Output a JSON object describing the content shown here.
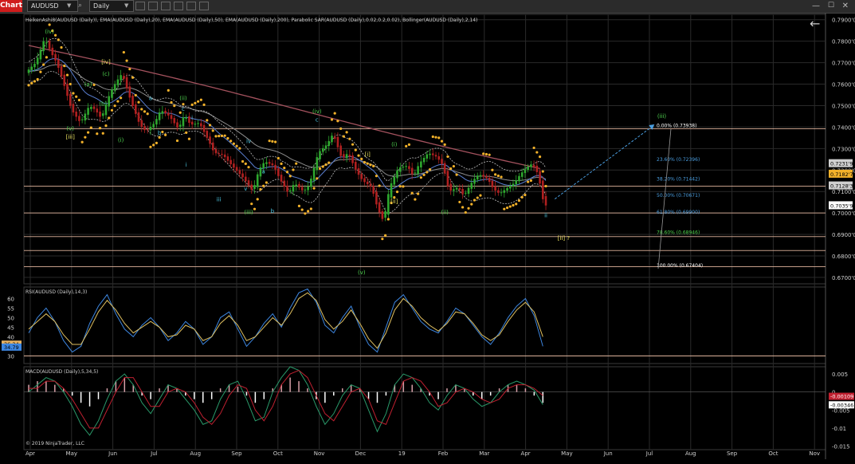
{
  "toolbar": {
    "chart_tab": "Chart",
    "symbol": "AUDUSD",
    "timeframe": "Daily"
  },
  "colors": {
    "background": "#000000",
    "grid": "#2a2a2a",
    "candle_up": "#2ea82e",
    "candle_down": "#b02020",
    "sar": "#f2b12a",
    "ema20": "#5a7fd1",
    "ema50": "#8c8c8c",
    "ema200": "#a4525e",
    "bollinger": "#bfbfbf",
    "fib_line": "#e6b8a0",
    "rsi": "#3d86e0",
    "rsi_avg": "#e0c060",
    "macd_pos": "#d8a0a8",
    "macd_neg": "#ffffff",
    "macd_line": "#2a9a6a",
    "macd_signal": "#c02030",
    "wave_green": "#4ed24e",
    "wave_yellow": "#e8e060",
    "wave_cyan": "#4cc4e0",
    "projection": "#4a9ee0"
  },
  "chart_data": [
    {
      "type": "candlestick",
      "title": "HeikenAshi8(AUDUSD (Daily)), EMA(AUDUSD (Daily),20), EMA(AUDUSD (Daily),50), EMA(AUDUSD (Daily),200), Parabolic SAR(AUDUSD (Daily),0.02,0.2,0.02), Bollinger(AUDUSD (Daily),2,14)",
      "x_labels": [
        "Apr",
        "May",
        "Jun",
        "Jul",
        "Aug",
        "Sep",
        "Oct",
        "Nov",
        "Dec",
        "19",
        "Feb",
        "Mar",
        "Apr",
        "May",
        "Jun",
        "Jul",
        "Aug",
        "Sep",
        "Oct",
        "Nov"
      ],
      "y_ticks": [
        "0.7900'0",
        "0.7800'0",
        "0.7700'0",
        "0.7600'0",
        "0.7500'0",
        "0.7400'0",
        "0.7300'0",
        "0.7200'0",
        "0.7100'0",
        "0.7000'0",
        "0.6900'0",
        "0.6800'0",
        "0.6700'0"
      ],
      "ylim": [
        0.667,
        0.7925
      ],
      "price_path": [
        [
          0,
          0.766
        ],
        [
          3,
          0.77
        ],
        [
          6,
          0.7815
        ],
        [
          8,
          0.775
        ],
        [
          10,
          0.77
        ],
        [
          12,
          0.762
        ],
        [
          15,
          0.748
        ],
        [
          18,
          0.742
        ],
        [
          21,
          0.75
        ],
        [
          23,
          0.748
        ],
        [
          25,
          0.744
        ],
        [
          28,
          0.756
        ],
        [
          30,
          0.761
        ],
        [
          32,
          0.765
        ],
        [
          35,
          0.752
        ],
        [
          38,
          0.741
        ],
        [
          40,
          0.738
        ],
        [
          43,
          0.742
        ],
        [
          45,
          0.748
        ],
        [
          48,
          0.745
        ],
        [
          51,
          0.739
        ],
        [
          53,
          0.746
        ],
        [
          55,
          0.741
        ],
        [
          58,
          0.742
        ],
        [
          61,
          0.734
        ],
        [
          63,
          0.728
        ],
        [
          66,
          0.727
        ],
        [
          69,
          0.722
        ],
        [
          71,
          0.719
        ],
        [
          73,
          0.716
        ],
        [
          76,
          0.71
        ],
        [
          78,
          0.72
        ],
        [
          80,
          0.724
        ],
        [
          83,
          0.722
        ],
        [
          85,
          0.716
        ],
        [
          88,
          0.709
        ],
        [
          90,
          0.714
        ],
        [
          93,
          0.71
        ],
        [
          95,
          0.713
        ],
        [
          98,
          0.728
        ],
        [
          101,
          0.732
        ],
        [
          103,
          0.737
        ],
        [
          106,
          0.725
        ],
        [
          108,
          0.728
        ],
        [
          111,
          0.719
        ],
        [
          113,
          0.715
        ],
        [
          116,
          0.712
        ],
        [
          118,
          0.702
        ],
        [
          120,
          0.696
        ],
        [
          122,
          0.712
        ],
        [
          125,
          0.721
        ],
        [
          128,
          0.722
        ],
        [
          130,
          0.717
        ],
        [
          132,
          0.723
        ],
        [
          135,
          0.728
        ],
        [
          138,
          0.726
        ],
        [
          140,
          0.722
        ],
        [
          142,
          0.71
        ],
        [
          145,
          0.712
        ],
        [
          147,
          0.708
        ],
        [
          150,
          0.715
        ],
        [
          152,
          0.718
        ],
        [
          155,
          0.716
        ],
        [
          157,
          0.711
        ],
        [
          159,
          0.709
        ],
        [
          161,
          0.711
        ],
        [
          164,
          0.714
        ],
        [
          166,
          0.718
        ],
        [
          168,
          0.721
        ],
        [
          170,
          0.723
        ],
        [
          172,
          0.718
        ],
        [
          174,
          0.7035
        ]
      ],
      "candle_days": 175,
      "date_range_days": 300,
      "current_price": "0.7035'9",
      "price_markers": [
        {
          "label": "0.7231'9",
          "value": 0.72319,
          "bg": "#cfcfcf",
          "fg": "#000000"
        },
        {
          "label": "0.7182'7",
          "value": 0.71827,
          "bg": "#f2b12a",
          "fg": "#000000"
        },
        {
          "label": "0.7128'3",
          "value": 0.71283,
          "bg": "#cfcfcf",
          "fg": "#000000"
        },
        {
          "label": "0.7035'9",
          "value": 0.70359,
          "bg": "#ffffff",
          "fg": "#000000"
        }
      ],
      "horizontal_levels": [
        0.7392,
        0.7125,
        0.7,
        0.689,
        0.6825,
        0.675
      ],
      "fib_levels": [
        {
          "label": "0.00% (0.73938)",
          "value": 0.7392,
          "color": "#ffffff"
        },
        {
          "label": "23.60% (0.72396)",
          "value": 0.7235,
          "color": "#4a9ee0"
        },
        {
          "label": "38.20% (0.71442)",
          "value": 0.7144,
          "color": "#4a9ee0"
        },
        {
          "label": "50.00% (0.70671)",
          "value": 0.7067,
          "color": "#4a9ee0"
        },
        {
          "label": "61.80% (0.69900)",
          "value": 0.699,
          "color": "#4a9ee0"
        },
        {
          "label": "78.60% (0.68946)",
          "value": 0.6895,
          "color": "#4ed24e"
        },
        {
          "label": "100.00% (0.67404)",
          "value": 0.674,
          "color": "#ffffff"
        }
      ],
      "wave_labels": [
        {
          "text": "(iv)",
          "day": 7,
          "price": 0.7835,
          "color": "wave_green"
        },
        {
          "text": "(a)",
          "day": 20,
          "price": 0.759,
          "color": "wave_green"
        },
        {
          "text": "(v)",
          "day": 14,
          "price": 0.7385,
          "color": "wave_green"
        },
        {
          "text": "[iii]",
          "day": 14,
          "price": 0.7345,
          "color": "wave_yellow"
        },
        {
          "text": "(b)",
          "day": 25,
          "price": 0.75,
          "color": "wave_green"
        },
        {
          "text": "[iv]",
          "day": 26,
          "price": 0.7695,
          "color": "wave_yellow"
        },
        {
          "text": "(c)",
          "day": 26,
          "price": 0.764,
          "color": "wave_green"
        },
        {
          "text": "(i)",
          "day": 31,
          "price": 0.733,
          "color": "wave_green"
        },
        {
          "text": "a",
          "day": 41,
          "price": 0.7525,
          "color": "wave_cyan"
        },
        {
          "text": "b",
          "day": 44,
          "price": 0.7365,
          "color": "wave_cyan"
        },
        {
          "text": "(ii)",
          "day": 52,
          "price": 0.7525,
          "color": "wave_green"
        },
        {
          "text": "c",
          "day": 52,
          "price": 0.7475,
          "color": "wave_cyan"
        },
        {
          "text": "i",
          "day": 55,
          "price": 0.7435,
          "color": "wave_cyan"
        },
        {
          "text": "i",
          "day": 53,
          "price": 0.7215,
          "color": "wave_cyan"
        },
        {
          "text": "iii",
          "day": 64,
          "price": 0.7055,
          "color": "wave_cyan"
        },
        {
          "text": "iv",
          "day": 74,
          "price": 0.7325,
          "color": "wave_cyan"
        },
        {
          "text": "a",
          "day": 79,
          "price": 0.7185,
          "color": "wave_cyan"
        },
        {
          "text": "v",
          "day": 73,
          "price": 0.7105,
          "color": "wave_cyan"
        },
        {
          "text": "(iii)",
          "day": 74,
          "price": 0.6995,
          "color": "wave_green"
        },
        {
          "text": "b",
          "day": 82,
          "price": 0.7,
          "color": "wave_cyan"
        },
        {
          "text": "(iv)",
          "day": 97,
          "price": 0.7465,
          "color": "wave_green"
        },
        {
          "text": "c",
          "day": 97,
          "price": 0.7425,
          "color": "wave_cyan"
        },
        {
          "text": "[i]",
          "day": 114,
          "price": 0.7265,
          "color": "wave_yellow"
        },
        {
          "text": "(i)",
          "day": 123,
          "price": 0.731,
          "color": "wave_green"
        },
        {
          "text": "[ii]",
          "day": 123,
          "price": 0.7045,
          "color": "wave_yellow"
        },
        {
          "text": "(ii)",
          "day": 140,
          "price": 0.6995,
          "color": "wave_green"
        },
        {
          "text": "(v)",
          "day": 112,
          "price": 0.6715,
          "color": "wave_green"
        },
        {
          "text": "ii",
          "day": 174,
          "price": 0.698,
          "color": "wave_cyan"
        },
        {
          "text": "[ii] ?",
          "day": 180,
          "price": 0.6875,
          "color": "wave_yellow"
        },
        {
          "text": "(iii)",
          "day": 213,
          "price": 0.7443,
          "color": "wave_green"
        }
      ],
      "projection": {
        "from": [
          177,
          0.7065
        ],
        "to": [
          210,
          0.7405
        ]
      }
    },
    {
      "type": "line",
      "title": "RSI(AUDUSD (Daily),14,3)",
      "y_ticks": [
        "60",
        "55",
        "50",
        "45",
        "40",
        "35",
        "30"
      ],
      "ylim": [
        26,
        66
      ],
      "series": [
        {
          "name": "RSI",
          "values": [
            42,
            50,
            55,
            48,
            38,
            32,
            35,
            47,
            56,
            62,
            52,
            44,
            40,
            46,
            50,
            45,
            38,
            42,
            48,
            44,
            36,
            40,
            50,
            53,
            44,
            35,
            40,
            47,
            52,
            45,
            55,
            63,
            65,
            58,
            46,
            42,
            50,
            56,
            45,
            36,
            32,
            45,
            58,
            62,
            55,
            48,
            44,
            42,
            48,
            55,
            52,
            46,
            40,
            36,
            42,
            50,
            56,
            60,
            51,
            35
          ]
        },
        {
          "name": "Signal",
          "values": [
            44,
            48,
            52,
            48,
            41,
            36,
            36,
            44,
            53,
            59,
            54,
            47,
            42,
            45,
            48,
            45,
            40,
            41,
            46,
            44,
            38,
            40,
            47,
            51,
            46,
            38,
            40,
            45,
            50,
            46,
            52,
            60,
            63,
            59,
            49,
            44,
            48,
            54,
            47,
            39,
            34,
            42,
            54,
            60,
            56,
            50,
            46,
            43,
            47,
            53,
            52,
            47,
            41,
            38,
            41,
            48,
            54,
            58,
            53,
            40
          ]
        }
      ],
      "markers": [
        {
          "label": "36.34",
          "value": 36.34,
          "bg": "#e6b060",
          "fg": "#000000"
        },
        {
          "label": "34.79",
          "value": 34.79,
          "bg": "#3d86e0",
          "fg": "#000000"
        }
      ]
    },
    {
      "type": "bar",
      "title": "MACD(AUDUSD (Daily),5,34,5)",
      "y_ticks": [
        "0.005",
        "0",
        "-0.005",
        "-0.01",
        "-0.015"
      ],
      "ylim": [
        -0.016,
        0.007
      ],
      "histogram": [
        0.002,
        0.003,
        0.003,
        0.002,
        0.001,
        -0.001,
        -0.003,
        -0.004,
        -0.002,
        0.001,
        0.003,
        0.004,
        0.002,
        -0.001,
        -0.002,
        0.001,
        0.002,
        0.001,
        -0.001,
        -0.002,
        -0.003,
        -0.002,
        0.001,
        0.002,
        0.0015,
        -0.001,
        -0.003,
        -0.002,
        0.001,
        0.002,
        0.004,
        0.003,
        0.001,
        -0.002,
        -0.003,
        -0.001,
        0.001,
        0.002,
        0.001,
        -0.002,
        -0.003,
        -0.001,
        0.002,
        0.003,
        0.002,
        0.001,
        -0.001,
        -0.002,
        0.001,
        0.002,
        0.001,
        -0.001,
        -0.002,
        -0.001,
        0.001,
        0.002,
        0.002,
        0.001,
        -0.001,
        -0.003
      ],
      "macd_line": [
        0,
        0.002,
        0.004,
        0.003,
        0,
        -0.004,
        -0.009,
        -0.012,
        -0.008,
        -0.002,
        0.003,
        0.005,
        0.002,
        -0.003,
        -0.006,
        -0.002,
        0.002,
        0.001,
        -0.002,
        -0.005,
        -0.009,
        -0.008,
        -0.002,
        0.002,
        0.003,
        -0.002,
        -0.008,
        -0.007,
        0,
        0.004,
        0.007,
        0.006,
        0.002,
        -0.004,
        -0.009,
        -0.006,
        -0.001,
        0.002,
        0.001,
        -0.005,
        -0.011,
        -0.006,
        0.002,
        0.005,
        0.004,
        0.001,
        -0.003,
        -0.005,
        -0.001,
        0.002,
        0.001,
        -0.002,
        -0.004,
        -0.003,
        0,
        0.002,
        0.003,
        0.002,
        0.0005,
        -0.0035
      ],
      "signal_line": [
        0.001,
        0.001,
        0.003,
        0.003,
        0.001,
        -0.002,
        -0.006,
        -0.01,
        -0.01,
        -0.005,
        0,
        0.004,
        0.004,
        0,
        -0.004,
        -0.004,
        0,
        0.001,
        0,
        -0.003,
        -0.007,
        -0.009,
        -0.006,
        -0.001,
        0.002,
        0.001,
        -0.005,
        -0.008,
        -0.004,
        0.002,
        0.005,
        0.006,
        0.004,
        -0.001,
        -0.006,
        -0.008,
        -0.004,
        0,
        0.001,
        -0.002,
        -0.008,
        -0.009,
        -0.003,
        0.003,
        0.004,
        0.003,
        0,
        -0.004,
        -0.003,
        0,
        0.001,
        0,
        -0.002,
        -0.003,
        -0.002,
        0.001,
        0.002,
        0.002,
        0.001,
        -0.001
      ],
      "markers": [
        {
          "label": "-0.00109",
          "value": -0.00109,
          "bg": "#c02030",
          "fg": "#ffffff"
        },
        {
          "label": "-0.00346",
          "value": -0.00346,
          "bg": "#ffffff",
          "fg": "#000000"
        }
      ],
      "copyright": "© 2019 NinjaTrader, LLC"
    }
  ]
}
